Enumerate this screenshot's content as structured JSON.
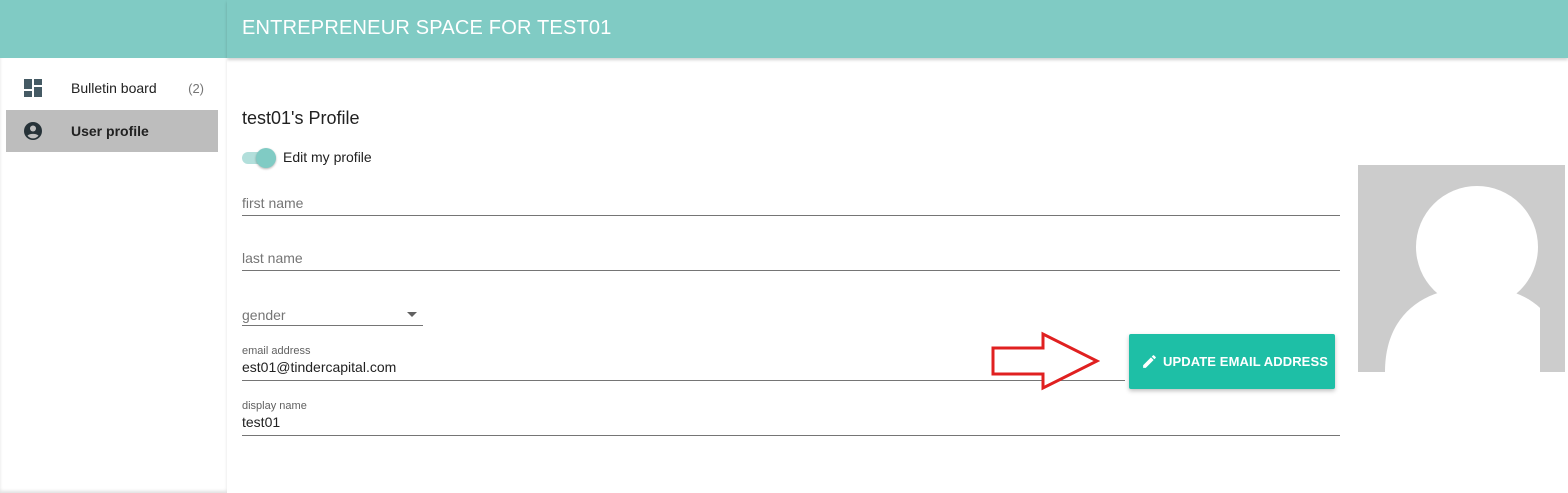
{
  "header": {
    "title": "ENTREPRENEUR SPACE FOR TEST01"
  },
  "sidebar": {
    "items": [
      {
        "label": "Bulletin board",
        "count": "(2)",
        "icon": "dashboard-icon",
        "active": false
      },
      {
        "label": "User profile",
        "icon": "account-circle-icon",
        "active": true
      }
    ]
  },
  "profile": {
    "title": "test01's Profile",
    "edit_toggle": {
      "label": "Edit my profile",
      "on": true
    },
    "first_name": {
      "placeholder": "first name",
      "value": ""
    },
    "last_name": {
      "placeholder": "last name",
      "value": ""
    },
    "gender": {
      "placeholder": "gender",
      "value": ""
    },
    "email": {
      "label": "email address",
      "value": "est01@tindercapital.com"
    },
    "display_name": {
      "label": "display name",
      "value": "test01"
    },
    "update_email_button": {
      "label": "UPDATE EMAIL ADDRESS",
      "icon": "pencil-icon"
    },
    "avatar": {
      "icon": "default-avatar-icon"
    }
  },
  "annotation": {
    "icon": "red-arrow-icon",
    "color": "#e02020"
  },
  "colors": {
    "header": "#80cbc4",
    "accent": "#1ebfa6",
    "active_nav": "#bdbdbd",
    "avatar_bg": "#cccccc"
  }
}
